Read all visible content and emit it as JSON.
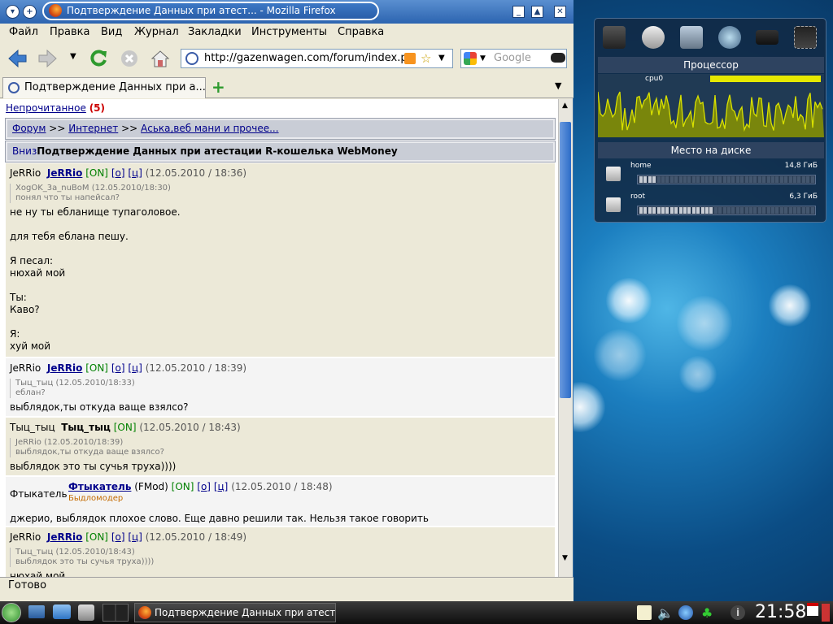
{
  "window": {
    "title": "Подтверждение Данных при атест... - Mozilla Firefox"
  },
  "menu": [
    "Файл",
    "Правка",
    "Вид",
    "Журнал",
    "Закладки",
    "Инструменты",
    "Справка"
  ],
  "nav": {
    "url": "http://gazenwagen.com/forum/index.pl",
    "search_placeholder": "Google"
  },
  "tabs": [
    {
      "label": "Подтверждение Данных при а..."
    }
  ],
  "forum": {
    "unread_label": "Непрочитанное",
    "unread_count": "(5)",
    "breadcrumb": {
      "forum": "Форум",
      "sep1": ">>",
      "internet": "Интернет",
      "sep2": ">>",
      "section": "Аська,веб мани и прочее..."
    },
    "down_link": "Вниз",
    "topic_title": "Подтверждение Данных при атестации R-кошелька WebMoney"
  },
  "posts": [
    {
      "author_small": "JeRRio",
      "author": "JeRRio",
      "status": "[ON]",
      "link_o": "[о]",
      "link_c": "[ц]",
      "date": "(12.05.2010 / 18:36)",
      "quote_head": "XogOK_3a_nuBoM (12.05.2010/18:30)",
      "quote_text": "понял что ты напейсал?",
      "text": "не ну ты ебланище тупаголовое.\n\nдля тебя еблана пешу.\n\nЯ песал:\nнюхай мой\n\nТы:\nКаво?\n\nЯ:\nхуй мой"
    },
    {
      "author_small": "JeRRio",
      "author": "JeRRio",
      "status": "[ON]",
      "link_o": "[о]",
      "link_c": "[ц]",
      "date": "(12.05.2010 / 18:39)",
      "quote_head": "Тыц_тыц (12.05.2010/18:33)",
      "quote_text": "еблан?",
      "text": "выблядок,ты откуда ваще взялсо?"
    },
    {
      "author_small": "Тыц_тыц",
      "author": "Тыц_тыц",
      "status": "[ON]",
      "date": "(12.05.2010 / 18:43)",
      "quote_head": "JeRRio (12.05.2010/18:39)",
      "quote_text": "выблядок,ты откуда ваще взялсо?",
      "text": "выблядок это ты сучья труха))))"
    },
    {
      "author_small": "Фтыкатель",
      "author": "Фтыкатель",
      "role": "(FMod)",
      "status": "[ON]",
      "link_o": "[о]",
      "link_c": "[ц]",
      "date": "(12.05.2010 / 18:48)",
      "title": "Быдломодер",
      "text": "джерио, выблядок плохое слово. Еще давно решили так. Нельзя такое говорить"
    },
    {
      "author_small": "JeRRio",
      "author": "JeRRio",
      "status": "[ON]",
      "link_o": "[о]",
      "link_c": "[ц]",
      "date": "(12.05.2010 / 18:49)",
      "quote_head": "Тыц_тыц (12.05.2010/18:43)",
      "quote_text": "выблядок это ты сучья труха))))",
      "text": "нюхай мой"
    }
  ],
  "statusbar": {
    "text": "Готово"
  },
  "sysmon": {
    "cpu_title": "Процессор",
    "cpu_label": "cpu0",
    "disk_title": "Место на диске",
    "disks": [
      {
        "name": "home",
        "size": "14,8 ГиБ",
        "used_fraction": 0.09
      },
      {
        "name": "root",
        "size": "6,3 ГиБ",
        "used_fraction": 0.42
      }
    ],
    "colors": {
      "graph": "#d8e000",
      "bg": "#203a54"
    }
  },
  "taskbar": {
    "task_label": "Подтверждение Данных при атест...",
    "clock": "21:58"
  }
}
